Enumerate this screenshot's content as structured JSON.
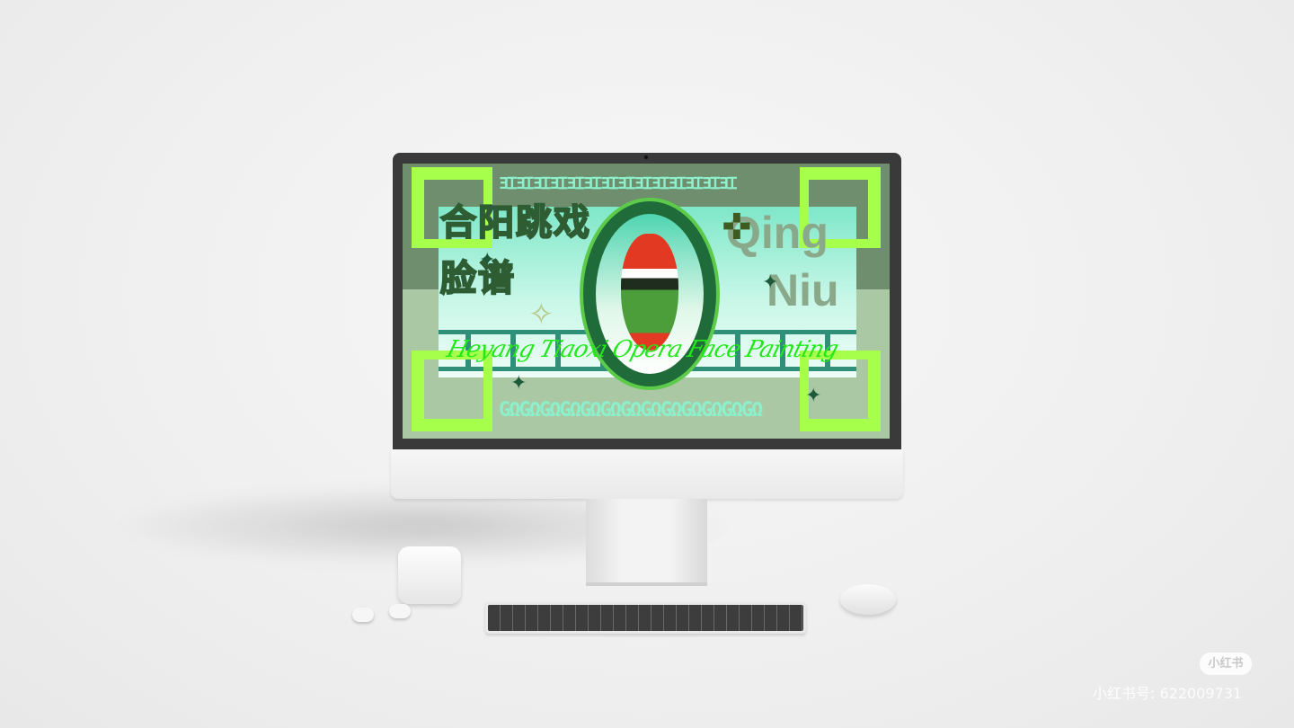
{
  "artwork": {
    "title_cn_line1": "合阳跳戏",
    "title_cn_line2": "脸谱",
    "latin_line1": "Qing",
    "latin_line2": "Niu",
    "subtitle": "Heyang Tiaoxi Opera Face Painting",
    "top_pattern": "ƎꞮƎꞮƎꞮƎꞮƎꞮƎꞮƎꞮƎꞮƎꞮƎꞮƎꞮƎꞮƎꞮƎꞮ",
    "bottom_pattern": "GΩGΩGΩGΩGΩGΩGΩGΩGΩGΩGΩGΩGΩ"
  },
  "watermark": {
    "badge": "小红书",
    "id_text": "小红书号: 622009731"
  },
  "colors": {
    "accent": "#a6ff4a",
    "subtitle": "#22e81a",
    "panel": "#7fe7c8"
  }
}
